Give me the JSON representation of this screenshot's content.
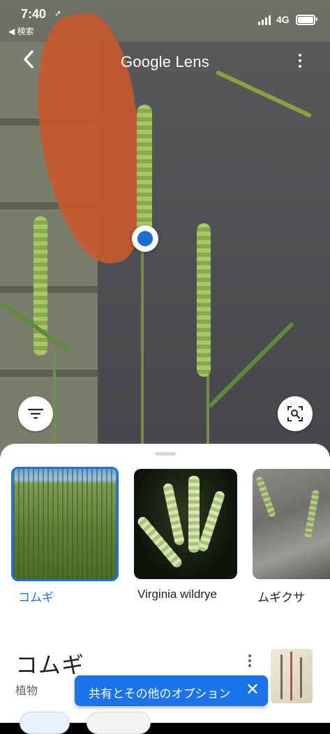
{
  "status_bar": {
    "time": "7:40",
    "back_app": "◀ 検索",
    "network": "4G"
  },
  "header": {
    "title": "Google Lens"
  },
  "results": [
    {
      "label": "コムギ",
      "selected": true
    },
    {
      "label": "Virginia wildrye",
      "selected": false
    },
    {
      "label": "ムギクサ",
      "selected": false
    }
  ],
  "detail": {
    "title": "コムギ",
    "subtitle": "植物"
  },
  "snackbar": {
    "text": "共有とその他のオプション",
    "close": "✕"
  },
  "colors": {
    "accent": "#1a73e8",
    "selected_label": "#1a73e8"
  },
  "icons": [
    "back-arrow-icon",
    "more-vert-icon",
    "filter-icon",
    "search-region-icon",
    "close-icon"
  ]
}
